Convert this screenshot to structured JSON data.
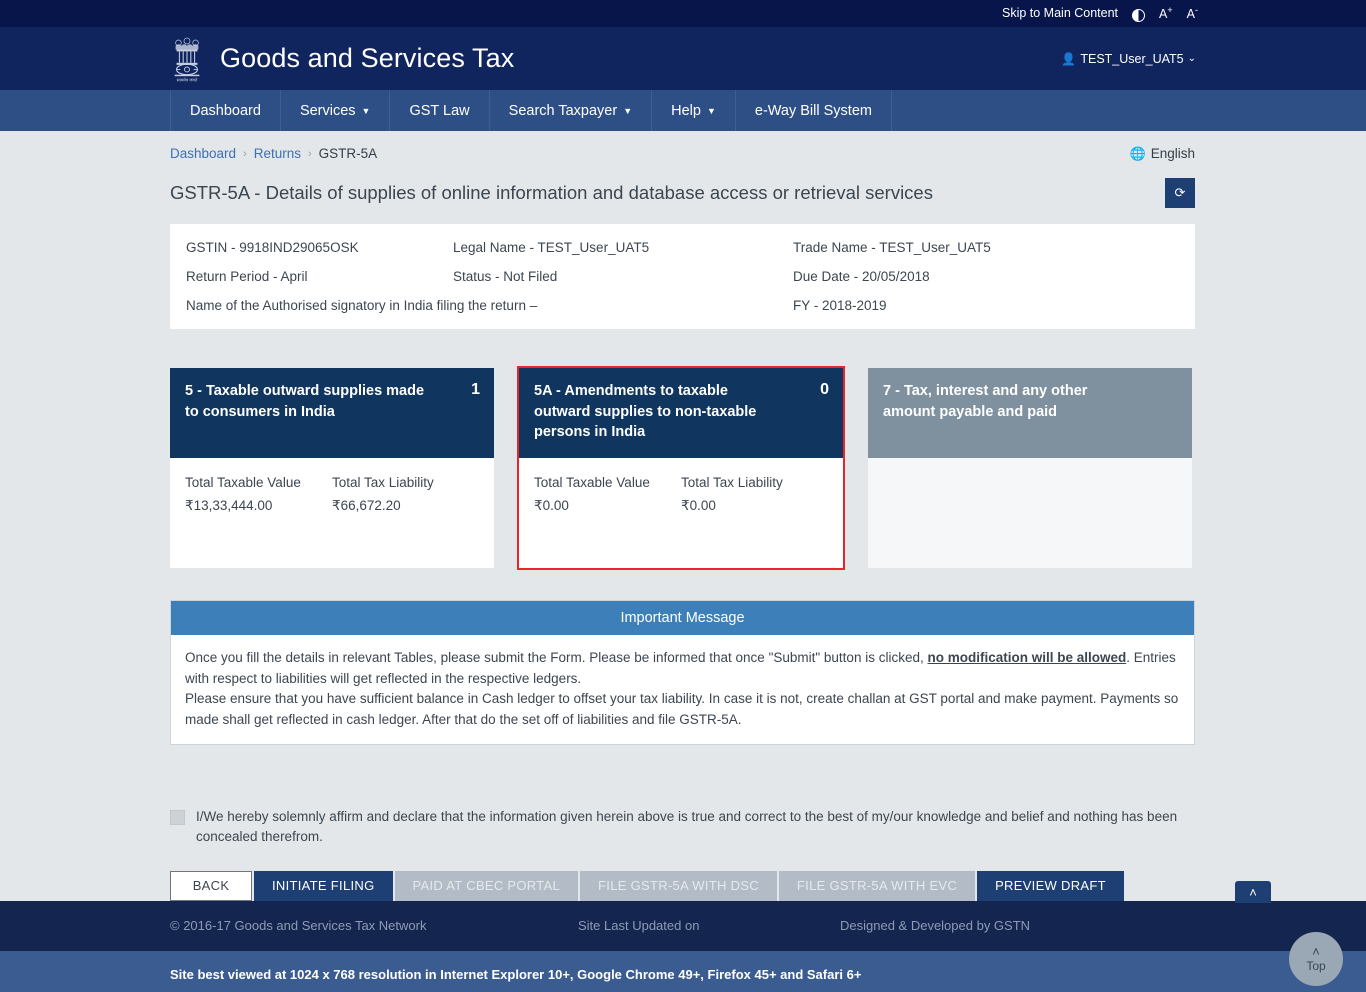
{
  "utility_bar": {
    "skip_link": "Skip to Main Content",
    "contrast_icon": "contrast-icon",
    "font_increase": "A",
    "font_increase_sup": "+",
    "font_decrease": "A",
    "font_decrease_sup": "-"
  },
  "header": {
    "emblem_icon": "india-national-emblem",
    "title": "Goods and Services Tax",
    "user_icon": "user-icon",
    "user_name": "TEST_User_UAT5",
    "user_caret": "⌄"
  },
  "nav": {
    "items": [
      {
        "label": "Dashboard",
        "has_dropdown": false
      },
      {
        "label": "Services",
        "has_dropdown": true
      },
      {
        "label": "GST Law",
        "has_dropdown": false
      },
      {
        "label": "Search Taxpayer",
        "has_dropdown": true
      },
      {
        "label": "Help",
        "has_dropdown": true
      },
      {
        "label": "e-Way Bill System",
        "has_dropdown": false
      }
    ],
    "caret": "▼"
  },
  "breadcrumb": {
    "items": [
      "Dashboard",
      "Returns",
      "GSTR-5A"
    ],
    "separator": "›",
    "language_icon": "globe-icon",
    "language": "English"
  },
  "page": {
    "title": "GSTR-5A - Details of supplies of online information and database access or retrieval services",
    "refresh_icon": "⟳"
  },
  "info_panel": {
    "gstin": "GSTIN - 9918IND29065OSK",
    "legal_name": "Legal Name - TEST_User_UAT5",
    "trade_name": "Trade Name - TEST_User_UAT5",
    "return_period": "Return Period - April",
    "status": "Status - Not Filed",
    "due_date": "Due Date - 20/05/2018",
    "auth_signatory": "Name of the Authorised signatory in India filing the return –",
    "fy": "FY - 2018-2019"
  },
  "tiles": [
    {
      "title": "5 - Taxable outward supplies made to consumers in India",
      "count": "1",
      "state": "normal",
      "fields": [
        {
          "label": "Total Taxable Value",
          "value": "₹13,33,444.00"
        },
        {
          "label": "Total Tax Liability",
          "value": "₹66,672.20"
        }
      ]
    },
    {
      "title": "5A - Amendments to taxable outward supplies to non-taxable persons in India",
      "count": "0",
      "state": "active",
      "fields": [
        {
          "label": "Total Taxable Value",
          "value": "₹0.00"
        },
        {
          "label": "Total Tax Liability",
          "value": "₹0.00"
        }
      ]
    },
    {
      "title": "7 - Tax, interest and any other amount payable and paid",
      "count": "",
      "state": "disabled",
      "fields": []
    }
  ],
  "important_message": {
    "heading": "Important Message",
    "line1_a": "Once you fill the details in relevant Tables, please submit the Form. Please be informed that once \"Submit\" button is clicked, ",
    "line1_bold": "no modification will be allowed",
    "line1_b": ". Entries with respect to liabilities will get reflected in the respective ledgers.",
    "line2": "Please ensure that you have sufficient balance in Cash ledger to offset your tax liability. In case it is not, create challan at GST portal and make payment. Payments so made shall get reflected in cash ledger. After that do the set off of liabilities and file GSTR-5A."
  },
  "declaration": {
    "checked": false,
    "text": "I/We hereby solemnly affirm and declare that the information given herein above is true and correct to the best of my/our knowledge and belief and nothing has been concealed therefrom."
  },
  "actions": [
    {
      "label": "BACK",
      "style": "back"
    },
    {
      "label": "INITIATE FILING",
      "style": "primary"
    },
    {
      "label": "PAID AT CBEC PORTAL",
      "style": "disabled"
    },
    {
      "label": "FILE GSTR-5A WITH DSC",
      "style": "disabled"
    },
    {
      "label": "FILE GSTR-5A WITH EVC",
      "style": "disabled"
    },
    {
      "label": "PREVIEW DRAFT",
      "style": "primary"
    }
  ],
  "footer": {
    "copyright": "© 2016-17 Goods and Services Tax Network",
    "last_updated": "Site Last Updated on",
    "designed_by": "Designed & Developed by GSTN",
    "best_viewed": "Site best viewed at 1024 x 768 resolution in Internet Explorer 10+, Google Chrome 49+, Firefox 45+ and Safari 6+"
  },
  "floating": {
    "chevron_icon": "˄",
    "top_chevron": "˄",
    "top_label": "Top"
  }
}
